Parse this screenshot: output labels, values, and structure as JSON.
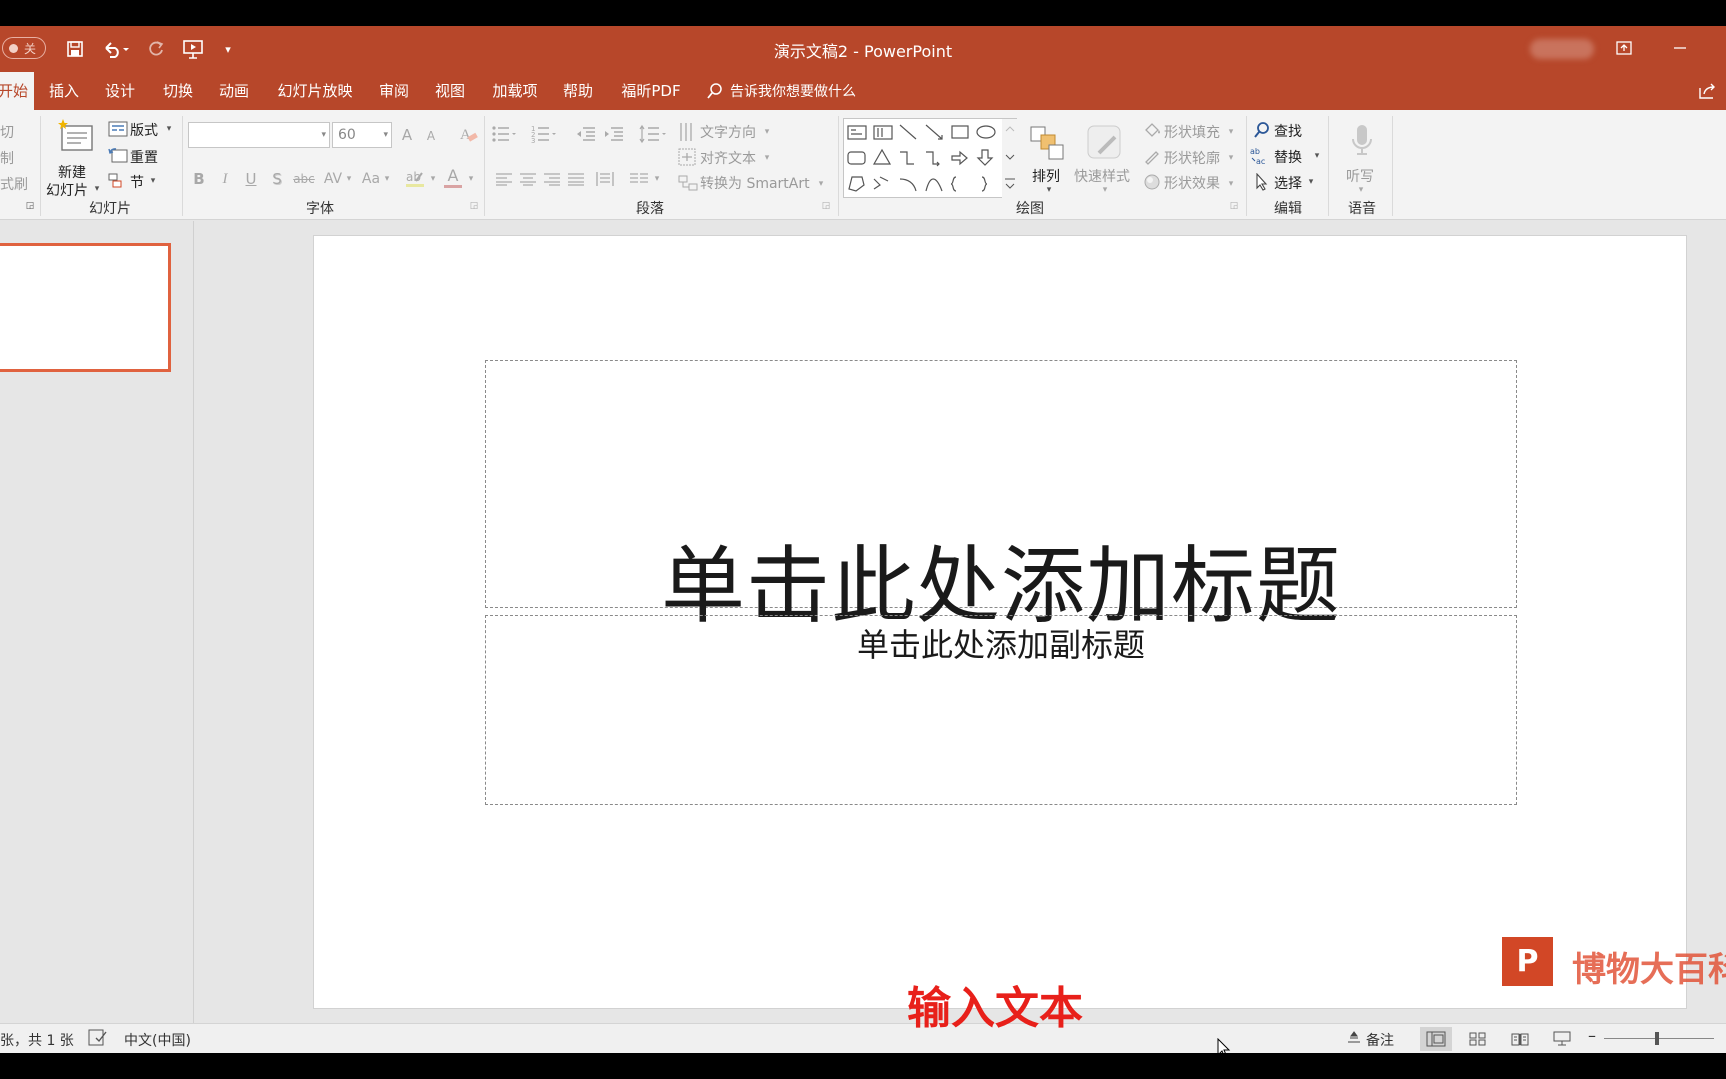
{
  "titlebar": {
    "title": "演示文稿2 - PowerPoint",
    "autosave_label": "关",
    "accent": "#b7472a"
  },
  "tabs": [
    {
      "label": "开始",
      "active": true
    },
    {
      "label": "插入"
    },
    {
      "label": "设计"
    },
    {
      "label": "切换"
    },
    {
      "label": "动画"
    },
    {
      "label": "幻灯片放映"
    },
    {
      "label": "审阅"
    },
    {
      "label": "视图"
    },
    {
      "label": "加载项"
    },
    {
      "label": "帮助"
    },
    {
      "label": "福昕PDF"
    }
  ],
  "tellme": "告诉我你想要做什么",
  "ribbon": {
    "clipboard": {
      "cut": "切",
      "copy": "制",
      "painter": "式刷"
    },
    "slides": {
      "new_slide_line1": "新建",
      "new_slide_line2": "幻灯片",
      "layout": "版式",
      "reset": "重置",
      "section": "节",
      "group_label": "幻灯片"
    },
    "font": {
      "font_name": "",
      "font_size": "60",
      "grow": "A",
      "shrink": "A",
      "bold": "B",
      "italic": "I",
      "underline": "U",
      "shadow": "S",
      "strike": "abc",
      "spacing": "AV",
      "case": "Aa",
      "color": "A",
      "group_label": "字体"
    },
    "paragraph": {
      "text_direction": "文字方向",
      "align_text": "对齐文本",
      "smartart": "转换为 SmartArt",
      "group_label": "段落"
    },
    "drawing": {
      "arrange": "排列",
      "quick_styles": "快速样式",
      "shape_fill": "形状填充",
      "shape_outline": "形状轮廓",
      "shape_effects": "形状效果",
      "group_label": "绘图"
    },
    "editing": {
      "find": "查找",
      "replace": "替换",
      "select": "选择",
      "group_label": "编辑"
    },
    "voice": {
      "dictate": "听写",
      "group_label": "语音"
    }
  },
  "slide": {
    "title_placeholder": "单击此处添加标题",
    "subtitle_placeholder": "单击此处添加副标题"
  },
  "caption": "输入文本",
  "watermark": {
    "logo": "P",
    "text": "博物大百科"
  },
  "statusbar": {
    "slide_count": "张，共 1 张",
    "language": "中文(中国)",
    "notes": "备注"
  }
}
